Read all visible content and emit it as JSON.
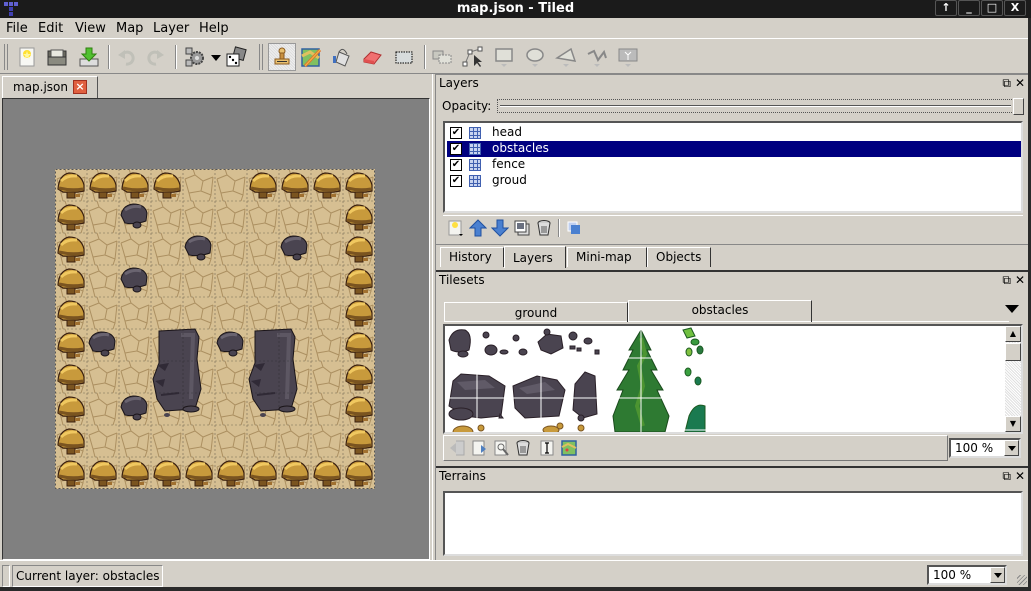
{
  "window": {
    "title": "map.json - Tiled",
    "buttons": [
      "↑",
      "_",
      "□",
      "X"
    ]
  },
  "menubar": [
    {
      "label": "File",
      "mnemonic": "F"
    },
    {
      "label": "Edit",
      "mnemonic": "E"
    },
    {
      "label": "View",
      "mnemonic": "V"
    },
    {
      "label": "Map",
      "mnemonic": "M"
    },
    {
      "label": "Layer",
      "mnemonic": "L"
    },
    {
      "label": "Help",
      "mnemonic": "H"
    }
  ],
  "toolbar": {
    "file_tools": [
      "new-map-icon",
      "open-icon",
      "save-icon"
    ],
    "history_tools": [
      "undo-icon",
      "redo-icon"
    ],
    "command_tools": [
      "commands-icon",
      "random-mode-icon"
    ],
    "edit_tools": [
      "stamp-brush-icon",
      "terrain-brush-icon",
      "bucket-fill-icon",
      "eraser-icon",
      "rectangular-select-icon"
    ],
    "object_tools": [
      "select-objects-icon",
      "edit-polygons-icon",
      "insert-rectangle-icon",
      "insert-ellipse-icon",
      "insert-polygon-icon",
      "insert-polyline-icon",
      "insert-tile-icon"
    ],
    "active_tool": "stamp-brush-icon"
  },
  "document": {
    "tab_label": "map.json",
    "map": {
      "width_tiles": 10,
      "height_tiles": 10,
      "fence_tiles": "border-except-top-gap",
      "top_gap_columns": [
        4,
        5
      ],
      "boulders": [
        [
          2,
          1
        ],
        [
          4,
          2
        ],
        [
          7,
          2
        ],
        [
          2,
          3
        ],
        [
          1,
          5
        ],
        [
          5,
          5
        ],
        [
          2,
          7
        ]
      ],
      "moai": [
        [
          3,
          5
        ],
        [
          6,
          5
        ]
      ],
      "colors": {
        "ground": "#d6bf92",
        "ground_crack": "#8a6a3a",
        "fence": "#c89a3c",
        "fence_dark": "#7a5420",
        "rock": "#4a4450",
        "rock_light": "#6a6470",
        "canvas_bg": "#808080"
      }
    }
  },
  "layers_panel": {
    "title": "Layers",
    "opacity_label": "Opacity:",
    "opacity_value": 1.0,
    "layers": [
      {
        "name": "head",
        "visible": true,
        "selected": false
      },
      {
        "name": "obstacles",
        "visible": true,
        "selected": true
      },
      {
        "name": "fence",
        "visible": true,
        "selected": false
      },
      {
        "name": "groud",
        "visible": true,
        "selected": false
      }
    ],
    "tools": [
      "new-layer-icon",
      "raise-layer-icon",
      "lower-layer-icon",
      "duplicate-layer-icon",
      "remove-layer-icon",
      "toggle-other-layers-icon"
    ],
    "selection_color": "#000080"
  },
  "dock_tabs": [
    {
      "label": "History",
      "selected": false
    },
    {
      "label": "Layers",
      "selected": true
    },
    {
      "label": "Mini-map",
      "selected": false
    },
    {
      "label": "Objects",
      "selected": false
    }
  ],
  "tilesets_panel": {
    "title": "Tilesets",
    "tabs": [
      {
        "label": "ground",
        "selected": false
      },
      {
        "label": "obstacles",
        "selected": true
      }
    ],
    "tools": [
      "import-tileset-icon",
      "export-tileset-icon",
      "tileset-properties-icon",
      "remove-tileset-icon",
      "edit-terrain-icon",
      "add-tiles-icon"
    ],
    "zoom": "100 %"
  },
  "terrains_panel": {
    "title": "Terrains",
    "zoom": "100 %"
  },
  "statusbar": {
    "current_layer_text": "Current layer: obstacles"
  }
}
